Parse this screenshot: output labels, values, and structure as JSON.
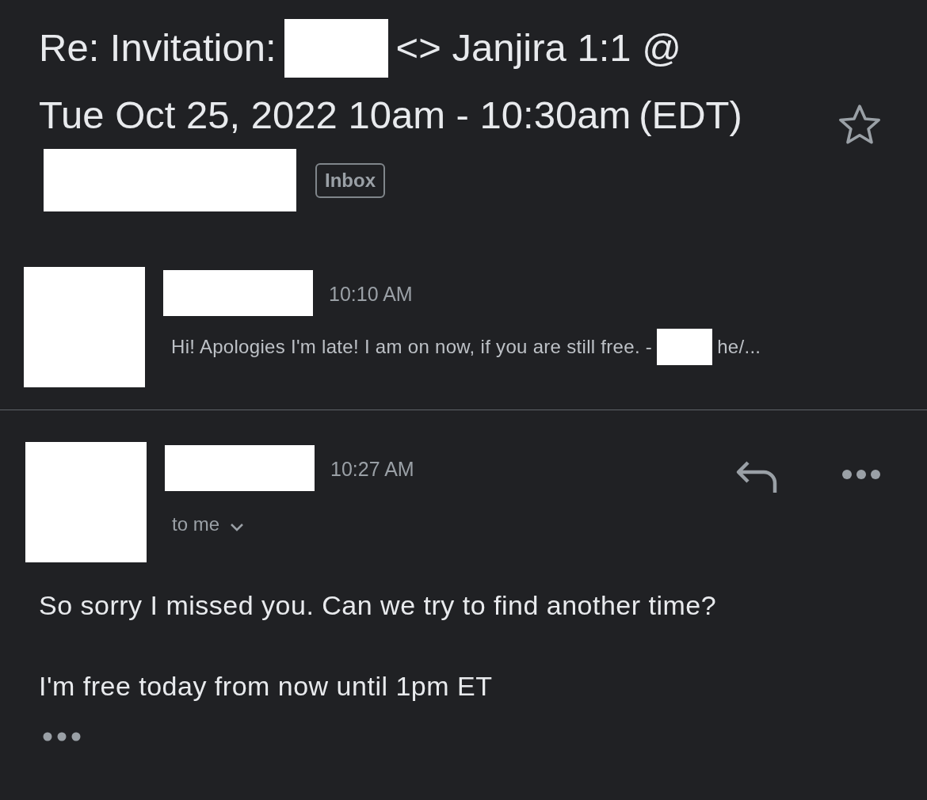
{
  "subject": [
    {
      "kind": "text",
      "text": "Re: Invitation:"
    },
    {
      "kind": "redaction"
    },
    {
      "kind": "text",
      "text": "<> Janjira 1:1 @"
    },
    {
      "kind": "text",
      "text": "Tue Oct 25, 2022 10am - 10:30am"
    },
    {
      "kind": "text",
      "text": "(EDT)"
    },
    {
      "kind": "redaction"
    }
  ],
  "label": "Inbox",
  "starred": false,
  "messages": [
    {
      "expanded": false,
      "time": "10:10 AM",
      "snippet": [
        {
          "kind": "text",
          "text": "Hi! Apologies I'm late! I am on now, if you are still free. -"
        },
        {
          "kind": "redaction"
        },
        {
          "kind": "text",
          "text": "he/..."
        }
      ]
    },
    {
      "expanded": true,
      "time": "10:27 AM",
      "recipient": "to me",
      "body": [
        "So sorry I missed you. Can we try to find another time?",
        "I'm free today from now until 1pm ET"
      ]
    }
  ]
}
